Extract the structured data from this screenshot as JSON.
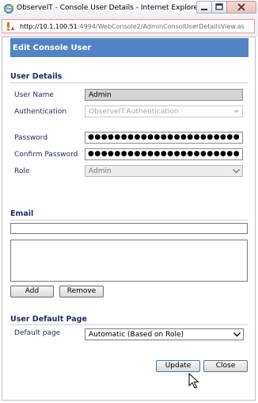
{
  "window": {
    "title": "ObserveIT - Console User Details - Internet Explorer",
    "url_host": "http://10.1.100.51",
    "url_rest": ":4994/WebConsole2/AdminConsolUserDetailsView.as"
  },
  "dialog": {
    "title": "Edit Console User"
  },
  "user_details": {
    "section_title": "User Details",
    "user_name_label": "User Name",
    "user_name_value": "Admin",
    "authentication_label": "Authentication",
    "authentication_value": "ObserveIT.Authentication",
    "password_label": "Password",
    "password_value": "●●●●●●●●●●●●●●●●●●●●●●●●●●●●●",
    "confirm_password_label": "Confirm Password",
    "confirm_password_value": "●●●●●●●●●●●●●●●●●●●●●●●●●●●●●",
    "role_label": "Role",
    "role_value": "Admin"
  },
  "email": {
    "section_title": "Email",
    "input_value": "",
    "add_label": "Add",
    "remove_label": "Remove"
  },
  "default_page": {
    "section_title": "User Default Page",
    "label": "Default page",
    "value": "Automatic (Based on Role)"
  },
  "actions": {
    "update_label": "Update",
    "close_label": "Close"
  }
}
